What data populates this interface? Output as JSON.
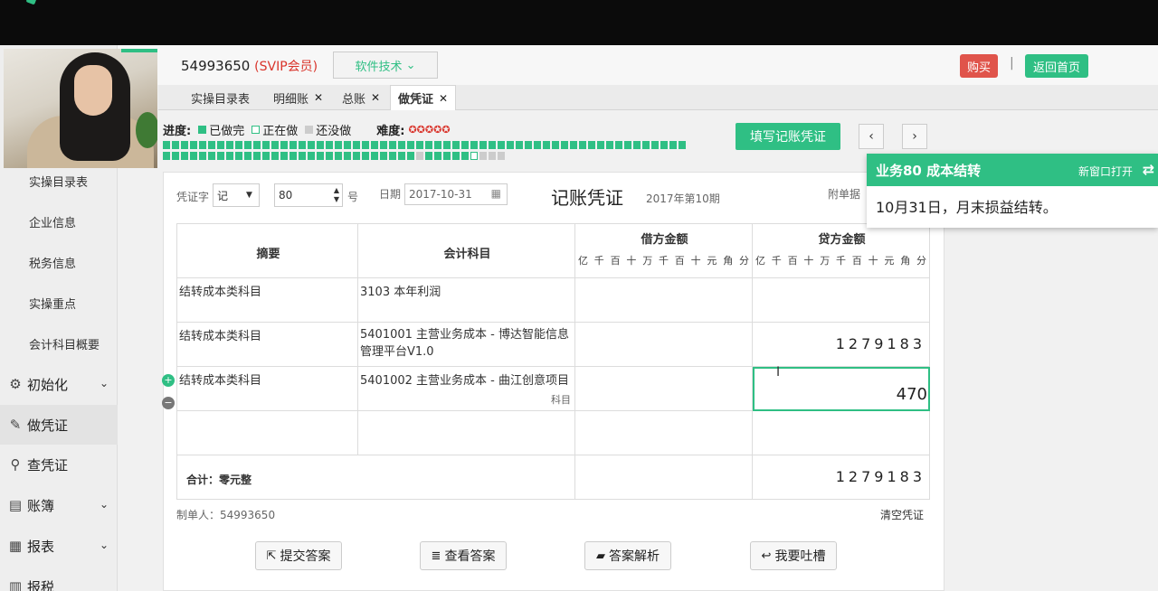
{
  "header": {
    "user_id": "54993650",
    "vip": "(SVIP会员)",
    "tech_label": "软件技术",
    "buy_label": "购买",
    "separator": "|",
    "home_label": "返回首页"
  },
  "tabs": [
    {
      "label": "实操目录表"
    },
    {
      "label": "明细账"
    },
    {
      "label": "总账"
    },
    {
      "label": "做凭证"
    }
  ],
  "sidebar": {
    "sub_items": [
      "实操目录表",
      "企业信息",
      "税务信息",
      "实操重点",
      "会计科目概要"
    ],
    "main_items": [
      {
        "label": "初始化",
        "icon": "gear-icon",
        "glyph": "⚙"
      },
      {
        "label": "做凭证",
        "icon": "pencil-icon",
        "glyph": "✎"
      },
      {
        "label": "查凭证",
        "icon": "search-icon",
        "glyph": "⚲"
      },
      {
        "label": "账簿",
        "icon": "book-icon",
        "glyph": "▤"
      },
      {
        "label": "报表",
        "icon": "report-icon",
        "glyph": "▦"
      },
      {
        "label": "报税",
        "icon": "tax-icon",
        "glyph": "▥"
      }
    ]
  },
  "progress": {
    "label": "进度:",
    "done": "已做完",
    "doing": "正在做",
    "todo": "还没做",
    "difficulty_label": "难度:",
    "difficulty_stars": "✪✪✪✪✪",
    "colors": {
      "done": "#2fbf84",
      "todo": "#cccccc"
    }
  },
  "actions": {
    "fill_voucher": "填写记账凭证",
    "prev": "‹",
    "next": "›"
  },
  "voucher": {
    "type_label": "凭证字",
    "type_value": "记",
    "number": "80",
    "number_suffix": "号",
    "date_label": "日期",
    "date_value": "2017-10-31",
    "title": "记账凭证",
    "period": "2017年第10期",
    "attachment_label": "附单据",
    "col_summary": "摘要",
    "col_account": "会计科目",
    "col_debit": "借方金额",
    "col_credit": "贷方金额",
    "digit_units": [
      "亿",
      "千",
      "百",
      "十",
      "万",
      "千",
      "百",
      "十",
      "元",
      "角",
      "分"
    ],
    "rows": [
      {
        "summary": "结转成本类科目",
        "account": "3103 本年利润",
        "credit": ""
      },
      {
        "summary": "结转成本类科目",
        "account": "5401001 主营业务成本 - 博达智能信息管理平台V1.0",
        "credit": "1279183"
      },
      {
        "summary": "结转成本类科目",
        "account": "5401002 主营业务成本 - 曲江创意项目",
        "account_hint": "科目",
        "credit": "470"
      },
      {
        "summary": "",
        "account": "",
        "credit": ""
      }
    ],
    "total_label": "合计：零元整",
    "total_credit": "1279183",
    "maker": "制单人：54993650",
    "clear": "清空凭证"
  },
  "popup": {
    "title": "业务80 成本结转",
    "open_new": "新窗口打开",
    "switch_icon": "⇄",
    "body": "10月31日，月末损益结转。"
  },
  "bottom_buttons": [
    {
      "label": "提交答案",
      "icon": "external-link-icon",
      "glyph": "⇱"
    },
    {
      "label": "查看答案",
      "icon": "database-icon",
      "glyph": "≣"
    },
    {
      "label": "答案解析",
      "icon": "folder-icon",
      "glyph": "▰"
    },
    {
      "label": "我要吐槽",
      "icon": "reply-icon",
      "glyph": "↩"
    }
  ]
}
